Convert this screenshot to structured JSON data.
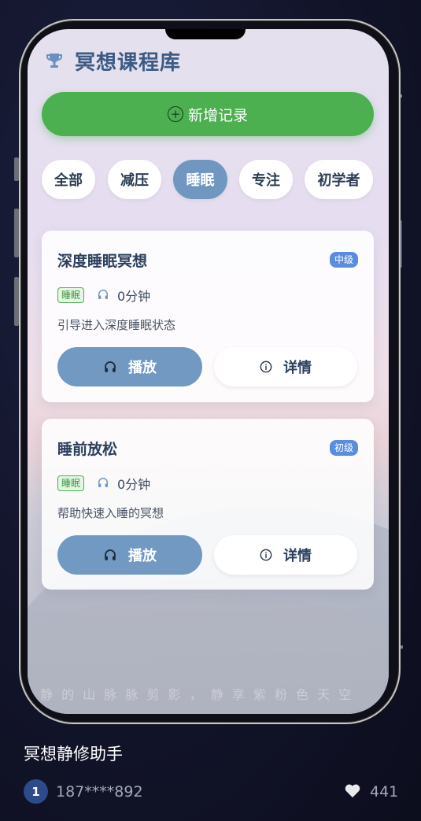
{
  "header": {
    "title": "冥想课程库",
    "icon": "trophy-icon"
  },
  "add_button": {
    "label": "新增记录",
    "icon": "plus-circle-icon"
  },
  "filters": [
    {
      "label": "全部",
      "active": false
    },
    {
      "label": "减压",
      "active": false
    },
    {
      "label": "睡眠",
      "active": true
    },
    {
      "label": "专注",
      "active": false
    },
    {
      "label": "初学者",
      "active": false
    }
  ],
  "courses": [
    {
      "title": "深度睡眠冥想",
      "level": "中级",
      "tag": "睡眠",
      "duration": "0分钟",
      "description": "引导进入深度睡眠状态",
      "play_label": "播放",
      "detail_label": "详情"
    },
    {
      "title": "睡前放松",
      "level": "初级",
      "tag": "睡眠",
      "duration": "0分钟",
      "description": "帮助快速入睡的冥想",
      "play_label": "播放",
      "detail_label": "详情"
    }
  ],
  "screen_footer_text": "静 的 山 脉 脉 剪 影 ， 静 享 紫 粉 色 天 空",
  "footer": {
    "app_name": "冥想静修助手",
    "rank": "1",
    "user": "187****892",
    "likes": "441"
  },
  "colors": {
    "accent": "#4caf50",
    "active_chip": "#6f97c0",
    "title": "#3c5a84",
    "level_badge": "#5b8ddf"
  }
}
